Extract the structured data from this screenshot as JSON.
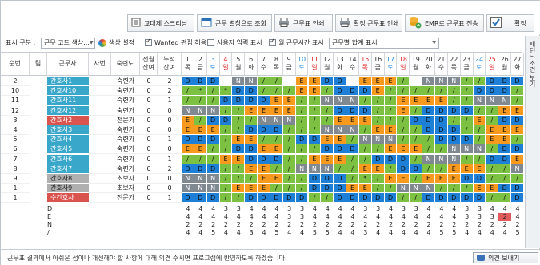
{
  "toolbar": {
    "buttons": [
      {
        "label": "교대제 스크리닝",
        "icon": "list-icon"
      },
      {
        "label": "근무 별칭으로 조회",
        "icon": "window-icon"
      },
      {
        "label": "근무표 인쇄",
        "icon": "printer-icon"
      },
      {
        "label": "확정 근무표 인쇄",
        "icon": "printer-icon"
      },
      {
        "label": "EMR로 근무표 전송",
        "icon": "database-transfer-icon"
      },
      {
        "label": "확정",
        "icon": "check-icon"
      }
    ]
  },
  "filters": {
    "display_label": "표시 구분 :",
    "display_value": "근무 코드 색상...",
    "color_settings": "색상 설정",
    "wanted_edit": "Wanted 편집 허용",
    "user_input": "사용자 입력 표시",
    "hours_display": "월 근무시간 표시",
    "summary_value": "근무별 합계 표시"
  },
  "sidebar": {
    "label": "패턴 / 조건 보기"
  },
  "columns": {
    "seq": "순번",
    "team": "팀",
    "worker": "근무자",
    "emp_no": "사번",
    "skill": "숙련도",
    "prev1": "전월",
    "prev2": "잔여",
    "acc1": "누적",
    "acc2": "잔여"
  },
  "days": [
    {
      "d": "1",
      "w": "목",
      "c": "n"
    },
    {
      "d": "2",
      "w": "금",
      "c": "n"
    },
    {
      "d": "3",
      "w": "토",
      "c": "b"
    },
    {
      "d": "4",
      "w": "일",
      "c": "r"
    },
    {
      "d": "5",
      "w": "월",
      "c": "n"
    },
    {
      "d": "6",
      "w": "화",
      "c": "n"
    },
    {
      "d": "7",
      "w": "수",
      "c": "n"
    },
    {
      "d": "8",
      "w": "목",
      "c": "n"
    },
    {
      "d": "9",
      "w": "금",
      "c": "n"
    },
    {
      "d": "10",
      "w": "토",
      "c": "b"
    },
    {
      "d": "11",
      "w": "일",
      "c": "r"
    },
    {
      "d": "12",
      "w": "월",
      "c": "n"
    },
    {
      "d": "13",
      "w": "화",
      "c": "n"
    },
    {
      "d": "14",
      "w": "수",
      "c": "n"
    },
    {
      "d": "15",
      "w": "목",
      "c": "r"
    },
    {
      "d": "16",
      "w": "금",
      "c": "n"
    },
    {
      "d": "17",
      "w": "토",
      "c": "b"
    },
    {
      "d": "18",
      "w": "일",
      "c": "r"
    },
    {
      "d": "19",
      "w": "월",
      "c": "n"
    },
    {
      "d": "20",
      "w": "화",
      "c": "n"
    },
    {
      "d": "21",
      "w": "수",
      "c": "n"
    },
    {
      "d": "22",
      "w": "목",
      "c": "n"
    },
    {
      "d": "23",
      "w": "금",
      "c": "n"
    },
    {
      "d": "24",
      "w": "토",
      "c": "b"
    },
    {
      "d": "25",
      "w": "일",
      "c": "r"
    },
    {
      "d": "26",
      "w": "월",
      "c": "n"
    },
    {
      "d": "27",
      "w": "화",
      "c": "n"
    }
  ],
  "shift_colors": {
    "D": "#1e7fd6",
    "E": "#f79a1e",
    "N": "#808890",
    "/": "#7cc142",
    "*": "#7cc142",
    "": "#ffffff"
  },
  "name_colors": {
    "blue": "#38a7c9",
    "red": "#d9534f",
    "gray": "#b0b0b0"
  },
  "nurses": [
    {
      "seq": "2",
      "name": "간호사1",
      "emp": "",
      "skill": "숙련가",
      "p": "0",
      "a": "2",
      "color": "blue",
      "shifts": [
        "D",
        "D",
        "D",
        "",
        "N",
        "N",
        "/",
        "/",
        "",
        "E",
        "E",
        "D",
        "D",
        "",
        "E",
        "E",
        "E",
        "/",
        "",
        "N",
        "N",
        "N",
        "/",
        "/",
        "D",
        "D",
        "D"
      ]
    },
    {
      "seq": "10",
      "name": "간호사10",
      "emp": "",
      "skill": "숙련가",
      "p": "0",
      "a": "2",
      "color": "blue",
      "shifts": [
        "/",
        "*",
        "/",
        "*",
        "D",
        "D",
        "/",
        "/",
        "/",
        "E",
        "E",
        "/",
        "D",
        "D",
        "D",
        "E",
        "/",
        "/",
        "/",
        "/",
        "/",
        "/",
        "/",
        "D",
        "D",
        "D",
        "/"
      ]
    },
    {
      "seq": "11",
      "name": "간호사11",
      "emp": "",
      "skill": "숙련가",
      "p": "0",
      "a": "1",
      "color": "blue",
      "shifts": [
        "/",
        "/",
        "/",
        "D",
        "D",
        "D",
        "D",
        "E",
        "E",
        "/",
        "/",
        "N",
        "N",
        "N",
        "/",
        "/",
        "/",
        "E",
        "E",
        "E",
        "E",
        "/",
        "/",
        "N",
        "N",
        "N",
        "/"
      ]
    },
    {
      "seq": "12",
      "name": "간호사12",
      "emp": "",
      "skill": "숙련가",
      "p": "0",
      "a": "0",
      "color": "blue",
      "shifts": [
        "N",
        "N",
        "N",
        "/",
        "/",
        "E",
        "E",
        "E",
        "E",
        "/",
        "/",
        "/",
        "D",
        "D",
        "D",
        "/",
        "/",
        "E",
        "/",
        "D",
        "D",
        "D",
        "D",
        "/",
        "/",
        "E",
        "E"
      ]
    },
    {
      "seq": "3",
      "name": "간호사2",
      "emp": "",
      "skill": "전문가",
      "p": "0",
      "a": "0",
      "color": "red",
      "shifts": [
        "E",
        "/",
        "D",
        "D",
        "/",
        "/",
        "N",
        "N",
        "N",
        "/",
        "/",
        "/",
        "E",
        "E",
        "E",
        "/",
        "/",
        "/",
        "D",
        "D",
        "D",
        "/",
        "/",
        "E",
        "/",
        "D",
        "D"
      ]
    },
    {
      "seq": "4",
      "name": "간호사3",
      "emp": "",
      "skill": "숙련가",
      "p": "0",
      "a": "0",
      "color": "blue",
      "shifts": [
        "E",
        "E",
        "E",
        "/",
        "/",
        "D",
        "D",
        "D",
        "/",
        "/",
        "/",
        "N",
        "N",
        "N",
        "/",
        "E",
        "E",
        "/",
        "/",
        "D",
        "D",
        "D",
        "/",
        "/",
        "E",
        "E",
        "E"
      ]
    },
    {
      "seq": "5",
      "name": "간호사4",
      "emp": "",
      "skill": "숙련가",
      "p": "0",
      "a": "1",
      "color": "blue",
      "shifts": [
        "D",
        "D",
        "D",
        "/",
        "E",
        "E",
        "/",
        "/",
        "/",
        "D",
        "D",
        "E",
        "E",
        "/",
        "N",
        "N",
        "N",
        "/",
        "/",
        "/",
        "D",
        "D",
        "D",
        "/",
        "E",
        "E",
        "/"
      ]
    },
    {
      "seq": "6",
      "name": "간호사5",
      "emp": "",
      "skill": "숙련가",
      "p": "0",
      "a": "0",
      "color": "blue",
      "shifts": [
        "E",
        "E",
        "/",
        "/",
        "D",
        "D",
        "E",
        "E",
        "/",
        "/",
        "/",
        "D",
        "D",
        "D",
        "/",
        "/",
        "E",
        "E",
        "E",
        "/",
        "/",
        "N",
        "N",
        "N",
        "/",
        "D",
        "D"
      ]
    },
    {
      "seq": "7",
      "name": "간호사6",
      "emp": "",
      "skill": "숙련가",
      "p": "0",
      "a": "1",
      "color": "blue",
      "shifts": [
        "/",
        "/",
        "/",
        "E",
        "E",
        "D",
        "D",
        "D",
        "/",
        "/",
        "E",
        "E",
        "E",
        "/",
        "/",
        "D",
        "D",
        "D",
        "/",
        "N",
        "N",
        "N",
        "/",
        "/",
        "D",
        "D",
        "E"
      ]
    },
    {
      "seq": "8",
      "name": "간호사7",
      "emp": "",
      "skill": "숙련가",
      "p": "0",
      "a": "2",
      "color": "blue",
      "shifts": [
        "D",
        "D",
        "D",
        "/",
        "/",
        "E",
        "E",
        "/",
        "/",
        "N",
        "N",
        "N",
        "/",
        "/",
        "E",
        "E",
        "/",
        "D",
        "D",
        "/",
        "/",
        "E",
        "E",
        "E",
        "/",
        "/",
        "N"
      ]
    },
    {
      "seq": "9",
      "name": "간호사8",
      "emp": "",
      "skill": "초보자",
      "p": "0",
      "a": "0",
      "color": "gray",
      "shifts": [
        "N",
        "N",
        "N",
        "/",
        "/",
        "/",
        "E",
        "E",
        "/",
        "/",
        "D",
        "D",
        "D",
        "/",
        "*",
        "/",
        "E",
        "E",
        "/",
        "E",
        "E",
        "E",
        "D",
        "D",
        "/",
        "/",
        "/"
      ]
    },
    {
      "seq": "1",
      "name": "간호사9",
      "emp": "",
      "skill": "초보자",
      "p": "0",
      "a": "0",
      "color": "gray",
      "shifts": [
        "N",
        "N",
        "N",
        "/",
        "E",
        "E",
        "E",
        "/",
        "/",
        "/",
        "D",
        "D",
        "D",
        "E",
        "E",
        "/",
        "/",
        "N",
        "N",
        "N",
        "/",
        "/",
        "/",
        "E",
        "E",
        "D",
        "D"
      ]
    },
    {
      "seq": "1",
      "name": "수간호사",
      "emp": "",
      "skill": "전문가",
      "p": "0",
      "a": "1",
      "color": "red",
      "shifts": [
        "D",
        "D",
        "D",
        "/",
        "/",
        "D",
        "D",
        "D",
        "D",
        "D",
        "/",
        "/",
        "D",
        "D",
        "D",
        "D",
        "D",
        "/",
        "/",
        "D",
        "D",
        "D",
        "D",
        "D",
        "/",
        "/",
        "D"
      ]
    }
  ],
  "summary": [
    {
      "label": "D",
      "vals": [
        "4",
        "4",
        "4",
        "3",
        "3",
        "4",
        "4",
        "4",
        "3",
        "3",
        "4",
        "4",
        "4",
        "4",
        "3",
        "3",
        "4",
        "3",
        "3",
        "4",
        "4",
        "4",
        "3",
        "3",
        "4",
        "4",
        "4"
      ],
      "hi": -1
    },
    {
      "label": "E",
      "vals": [
        "4",
        "4",
        "4",
        "4",
        "4",
        "4",
        "4",
        "4",
        "3",
        "3",
        "4",
        "4",
        "4",
        "4",
        "4",
        "4",
        "4",
        "4",
        "4",
        "4",
        "4",
        "4",
        "3",
        "3",
        "3",
        "2",
        "4"
      ],
      "hi": 25
    },
    {
      "label": "N",
      "vals": [
        "2",
        "2",
        "2",
        "2",
        "2",
        "2",
        "2",
        "2",
        "2",
        "2",
        "2",
        "2",
        "2",
        "2",
        "2",
        "2",
        "2",
        "2",
        "2",
        "2",
        "2",
        "2",
        "2",
        "2",
        "2",
        "2",
        "2"
      ],
      "hi": -1
    },
    {
      "label": "/",
      "vals": [
        "4",
        "4",
        "5",
        "4",
        "4",
        "3",
        "4",
        "5",
        "4",
        "4",
        "5",
        "5",
        "4",
        "4",
        "3",
        "4",
        "4",
        "4",
        "4",
        "4",
        "5",
        "5",
        "4",
        "4",
        "4",
        "4",
        "5"
      ],
      "hi": -1
    }
  ],
  "footer": {
    "message": "근무표 결과에서 아쉬운 점이나 개선해야 할 사항에 대해 의견 주시면 프로그램에 반영하도록 하겠습니다.",
    "button": "의견 보내기"
  }
}
